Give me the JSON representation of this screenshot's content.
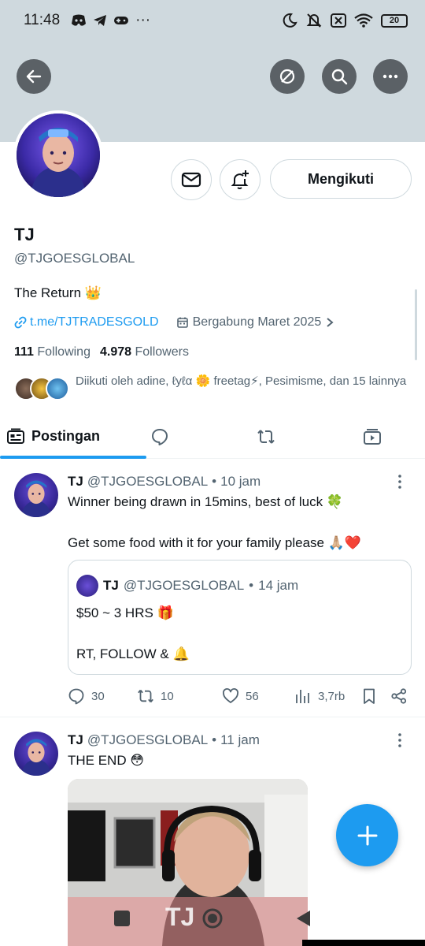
{
  "status_bar": {
    "time": "11:48",
    "dots": "···",
    "battery": "20"
  },
  "profile": {
    "name": "TJ",
    "handle": "@TJGOESGLOBAL",
    "bio": "The Return 👑",
    "link": "t.me/TJTRADESGOLD",
    "joined": "Bergabung Maret 2025",
    "following_count": "111",
    "following_label": "Following",
    "followers_count": "4.978",
    "followers_label": "Followers",
    "followed_by": "Diikuti oleh adine, ℓуℓα 🌼 freetag⚡, Pesimisme, dan 15 lainnya",
    "follow_button": "Mengikuti"
  },
  "tabs": [
    {
      "label": "Postingan",
      "icon": "posts-icon"
    },
    {
      "label": "",
      "icon": "replies-icon"
    },
    {
      "label": "",
      "icon": "reposts-icon"
    },
    {
      "label": "",
      "icon": "media-icon"
    }
  ],
  "tweets": [
    {
      "name": "TJ",
      "handle": "@TJGOESGLOBAL",
      "time": "10 jam",
      "text_line1": "Winner being drawn in 15mins, best of luck 🍀",
      "text_line2": "Get some food with it for your family please 🙏🏼❤️",
      "quote": {
        "name": "TJ",
        "handle": "@TJGOESGLOBAL",
        "time": "14 jam",
        "line1": "$50 ~ 3 HRS 🎁",
        "line2": "RT, FOLLOW & 🔔"
      },
      "replies": "30",
      "reposts": "10",
      "likes": "56",
      "views": "3,7rb"
    },
    {
      "name": "TJ",
      "handle": "@TJGOESGLOBAL",
      "time": "11 jam",
      "text": "THE END 😳",
      "media_watermark": "TJ"
    }
  ],
  "colors": {
    "accent": "#1d9bf0",
    "banner": "#cfd9de",
    "secondary_text": "#536471"
  }
}
